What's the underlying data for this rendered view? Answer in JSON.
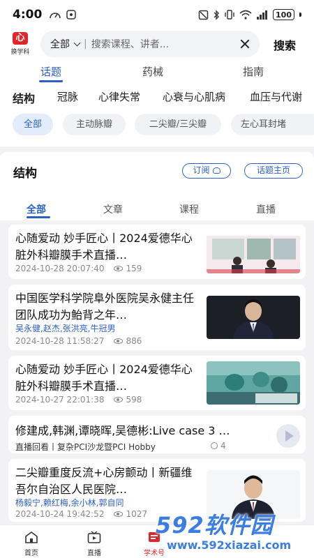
{
  "status_bar": {
    "time": "4:00",
    "battery": "100"
  },
  "header": {
    "logo_text": "换学科",
    "logo_mark": "心",
    "search_scope": "全部",
    "search_placeholder": "搜索课程、讲者...",
    "search_button": "搜索"
  },
  "top_tabs": [
    "话题",
    "药械",
    "指南"
  ],
  "categories": [
    "结构",
    "冠脉",
    "心律失常",
    "心衰与心肌病",
    "血压与代谢"
  ],
  "sub_chips": [
    "全部",
    "主动脉瓣",
    "二尖瓣/三尖瓣",
    "左心耳封堵"
  ],
  "topic": {
    "title": "结构",
    "subscribe_button": "订阅",
    "topic_home_button": "话题主页",
    "content_tabs": [
      "全部",
      "文章",
      "课程",
      "直播"
    ]
  },
  "items": [
    {
      "title": "心随爱动 妙手匠心丨2024爱德华心脏外科瓣膜手术直播…",
      "authors": "",
      "date": "2024-10-28 20:07:40",
      "views": "159"
    },
    {
      "title": "中国医学科学院阜外医院吴永健主任团队成功为鲐背之年…",
      "authors": "吴永健,赵杰,张洪亮,牛冠男",
      "date": "2024-10-28 11:58:27",
      "views": "886"
    },
    {
      "title": "心随爱动 妙手匠心丨2024爱德华心脏外科瓣膜手术直播…",
      "authors": "",
      "date": "2024-10-27 22:01:38",
      "views": "598"
    },
    {
      "title": "修建成,韩渊,谭晓晖,吴德彬:Live case 3 …",
      "subtitle": "直播回看丨复杂PCI沙龙暨PCI Hobby",
      "count": "4"
    },
    {
      "title": "二尖瓣重度反流+心房颤动丨新疆维吾尔自治区人民医院…",
      "authors": "杨毅宁,赖红梅,余小林,郭自同",
      "date": "2024-10-24 19:42:52",
      "views": "1027"
    }
  ],
  "bottom_nav": [
    "首页",
    "直播",
    "学术号"
  ],
  "watermark": {
    "main": "592软件园",
    "url": "www.592xiazai.com"
  },
  "colors": {
    "accent": "#2b5fc5",
    "brand_red": "#e0252b"
  }
}
